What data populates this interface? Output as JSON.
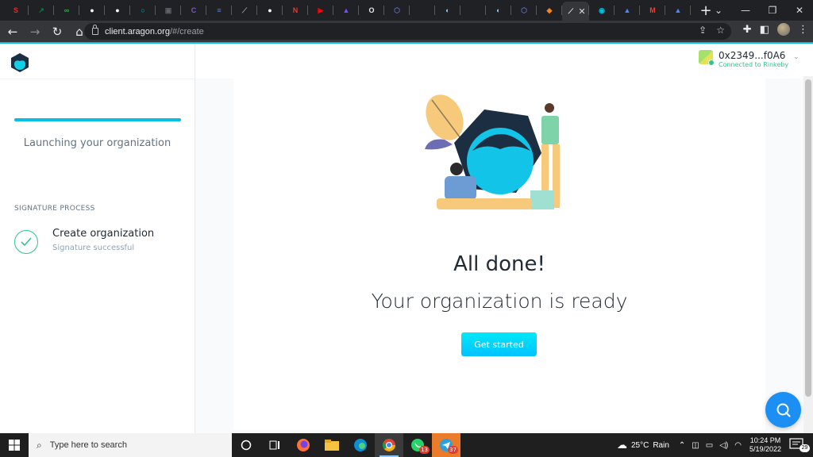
{
  "browser": {
    "tabs": [
      {
        "icon": "s-red-icon",
        "color": "#d93025",
        "glyph": "S"
      },
      {
        "icon": "chart-green-icon",
        "color": "#0b8043",
        "glyph": "↗"
      },
      {
        "icon": "infinity-green-icon",
        "color": "#34a853",
        "glyph": "∞"
      },
      {
        "icon": "white-circle-icon",
        "color": "#ffffff",
        "glyph": "●"
      },
      {
        "icon": "white-circle-icon-2",
        "color": "#ffffff",
        "glyph": "●"
      },
      {
        "icon": "ring-cyan-icon",
        "color": "#00bcd4",
        "glyph": "○"
      },
      {
        "icon": "box-grey-icon",
        "color": "#5f6368",
        "glyph": "▣"
      },
      {
        "icon": "c-purple-icon",
        "color": "#7e57c2",
        "glyph": "C"
      },
      {
        "icon": "docs-blue-icon",
        "color": "#4285f4",
        "glyph": "≡"
      },
      {
        "icon": "leaf-icon",
        "color": "#9aa0a6",
        "glyph": "⟋"
      },
      {
        "icon": "white-circle-icon-3",
        "color": "#ffffff",
        "glyph": "●"
      },
      {
        "icon": "n-red-icon",
        "color": "#e53935",
        "glyph": "N"
      },
      {
        "icon": "youtube-icon",
        "color": "#ff0000",
        "glyph": "▶"
      },
      {
        "icon": "triangle-purple-icon",
        "color": "#7c4dff",
        "glyph": "▲"
      },
      {
        "icon": "o-white-icon",
        "color": "#e8eaed",
        "glyph": "O"
      },
      {
        "icon": "hexagon-blue-icon",
        "color": "#5c6bc0",
        "glyph": "⬡"
      },
      {
        "icon": "blank-tab-icon",
        "color": "#202124",
        "glyph": ""
      },
      {
        "icon": "moon-blue-icon",
        "color": "#90caf9",
        "glyph": "◐"
      },
      {
        "icon": "blank-tab-icon-2",
        "color": "#202124",
        "glyph": ""
      },
      {
        "icon": "moon-blue-icon-2",
        "color": "#90caf9",
        "glyph": "◐"
      },
      {
        "icon": "hexagon-blue-icon-2",
        "color": "#5c6bc0",
        "glyph": "⬡"
      },
      {
        "icon": "metamask-fox-icon",
        "color": "#f6851b",
        "glyph": "◆"
      }
    ],
    "active_tab": {
      "icon": "leaf-icon",
      "glyph": "⟋",
      "close": "✕"
    },
    "tabs_after": [
      {
        "icon": "aragon-tab-icon",
        "color": "#00c2e0",
        "glyph": "◉"
      },
      {
        "icon": "triangle-blue-icon",
        "color": "#4c8bf5",
        "glyph": "▲"
      },
      {
        "icon": "gmail-icon",
        "color": "#ea4335",
        "glyph": "M"
      },
      {
        "icon": "triangle-blue-icon-2",
        "color": "#4c8bf5",
        "glyph": "▲"
      }
    ],
    "new_tab": "+",
    "url_host": "client.aragon.org",
    "url_path": "/#/create"
  },
  "sidebar": {
    "progress_fraction": 1.0,
    "launching_text": "Launching your organization",
    "section_heading": "SIGNATURE PROCESS",
    "steps": [
      {
        "title": "Create organization",
        "status": "Signature successful"
      }
    ]
  },
  "account": {
    "address": "0x2349...f0A6",
    "network": "Connected to Rinkeby"
  },
  "main": {
    "title": "All done!",
    "subtitle": "Your organization is ready",
    "cta_label": "Get started"
  },
  "taskbar": {
    "search_placeholder": "Type here to search",
    "whatsapp_badge": "13",
    "telegram_badge": "37",
    "weather_temp": "25°C",
    "weather_desc": "Rain",
    "time": "10:24 PM",
    "date": "5/19/2022",
    "notifications": "29"
  },
  "colors": {
    "accent": "#00c2e0",
    "success": "#2cc68f",
    "cta": "#00c2ff"
  }
}
